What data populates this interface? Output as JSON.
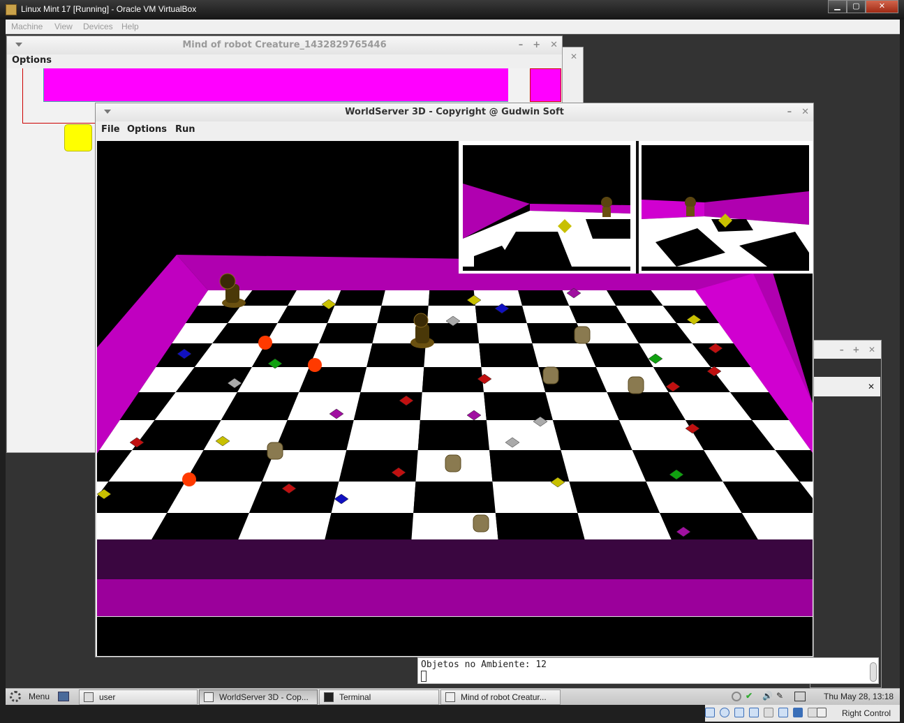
{
  "host": {
    "title": "Linux Mint 17 [Running] - Oracle VM VirtualBox",
    "menu": [
      "Machine",
      "View",
      "Devices",
      "Help"
    ],
    "status_host_key": "Right Control"
  },
  "mind_window": {
    "title": "Mind of robot Creature_1432829765446",
    "menu_options": "Options",
    "buttons": [
      "–",
      "+",
      "✕"
    ],
    "accent": "#ff00ff"
  },
  "worldserver": {
    "title": "WorldServer 3D - Copyright @ Gudwin Soft",
    "menu": {
      "file": "File",
      "options": "Options",
      "run": "Run"
    },
    "buttons": [
      "–",
      "✕"
    ],
    "colors": {
      "wall": "#c000c0",
      "wall_dark": "#3a0640",
      "floor_dark": "#000000",
      "floor_light": "#ffffff"
    }
  },
  "console": {
    "text": "Objetos no Ambiente: 12"
  },
  "taskbar": {
    "menu_label": "Menu",
    "tasks": [
      {
        "label": "user",
        "icon": "folder-icon"
      },
      {
        "label": "WorldServer 3D - Cop...",
        "icon": "java-icon",
        "active": true
      },
      {
        "label": "Terminal",
        "icon": "terminal-icon"
      },
      {
        "label": "Mind of robot Creatur...",
        "icon": "java-icon"
      }
    ],
    "clock": "Thu May 28, 13:18"
  }
}
